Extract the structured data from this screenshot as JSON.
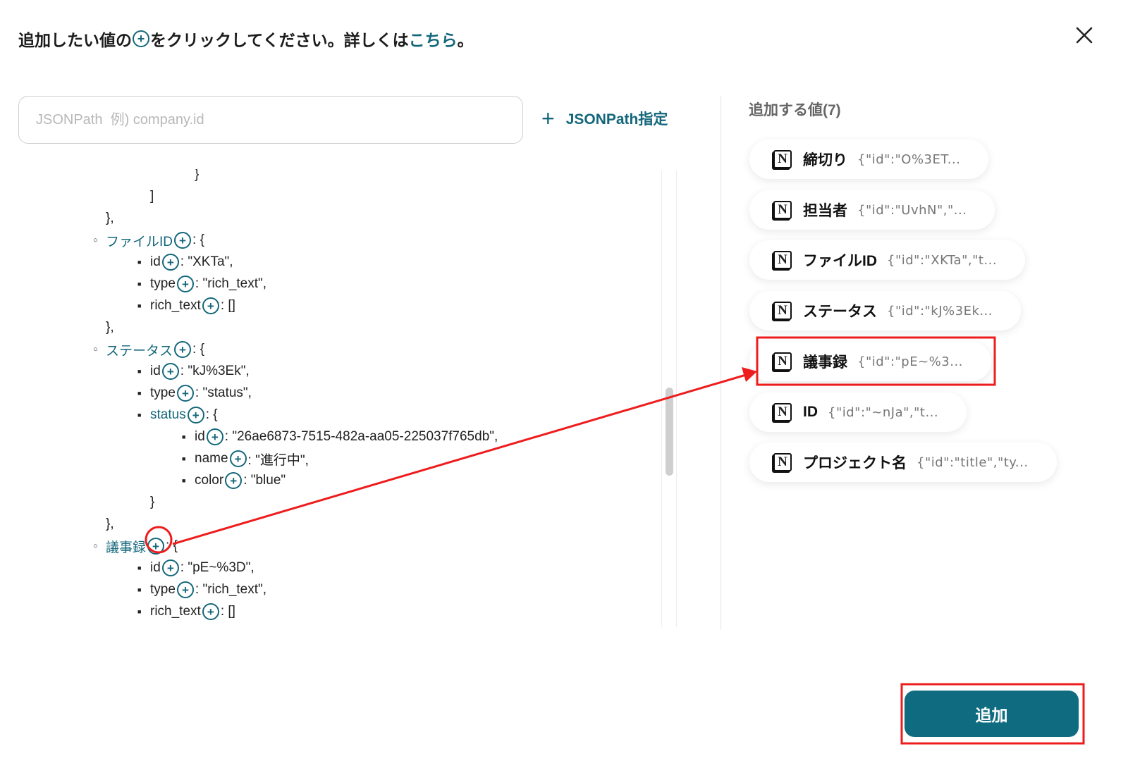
{
  "header": {
    "before": "追加したい値の",
    "after": "をクリックしてください。詳しくは",
    "link": "こちら",
    "end": "。"
  },
  "search": {
    "placeholder": "JSONPath  例) company.id",
    "value": ""
  },
  "jsonpath_button": "JSONPath指定",
  "tree": [
    {
      "level": 2,
      "type": "brace",
      "text": "}"
    },
    {
      "level": 1,
      "type": "brace",
      "text": "]"
    },
    {
      "level": 0,
      "type": "brace",
      "text": "},"
    },
    {
      "level": 0,
      "type": "obj",
      "key": "ファイルID",
      "suffix": ": {"
    },
    {
      "level": 1,
      "type": "kv",
      "key": "id",
      "suffix": ": \"XKTa\","
    },
    {
      "level": 1,
      "type": "kv",
      "key": "type",
      "suffix": ": \"rich_text\","
    },
    {
      "level": 1,
      "type": "kv",
      "key": "rich_text",
      "suffix": ": []"
    },
    {
      "level": 0,
      "type": "brace",
      "text": "},"
    },
    {
      "level": 0,
      "type": "obj",
      "key": "ステータス",
      "suffix": ": {"
    },
    {
      "level": 1,
      "type": "kv",
      "key": "id",
      "suffix": ": \"kJ%3Ek\","
    },
    {
      "level": 1,
      "type": "kv",
      "key": "type",
      "suffix": ": \"status\","
    },
    {
      "level": 1,
      "type": "obj",
      "key": "status",
      "suffix": ": {"
    },
    {
      "level": 2,
      "type": "kv",
      "key": "id",
      "suffix": ": \"26ae6873-7515-482a-aa05-225037f765db\","
    },
    {
      "level": 2,
      "type": "kv",
      "key": "name",
      "suffix": ": \"進行中\","
    },
    {
      "level": 2,
      "type": "kv",
      "key": "color",
      "suffix": ": \"blue\""
    },
    {
      "level": 1,
      "type": "brace",
      "text": "}"
    },
    {
      "level": 0,
      "type": "brace",
      "text": "},"
    },
    {
      "level": 0,
      "type": "obj",
      "key": "議事録",
      "suffix": ": {"
    },
    {
      "level": 1,
      "type": "kv",
      "key": "id",
      "suffix": ": \"pE~%3D\","
    },
    {
      "level": 1,
      "type": "kv",
      "key": "type",
      "suffix": ": \"rich_text\","
    },
    {
      "level": 1,
      "type": "kv",
      "key": "rich_text",
      "suffix": ": []"
    },
    {
      "level": 0,
      "type": "brace",
      "text": "},"
    }
  ],
  "right": {
    "title": "追加する値(7)",
    "items": [
      {
        "label": "締切り",
        "value": "{\"id\":\"O%3ET..."
      },
      {
        "label": "担当者",
        "value": "{\"id\":\"UvhN\",\"..."
      },
      {
        "label": "ファイルID",
        "value": "{\"id\":\"XKTa\",\"t..."
      },
      {
        "label": "ステータス",
        "value": "{\"id\":\"kJ%3Ek..."
      },
      {
        "label": "議事録",
        "value": "{\"id\":\"pE~%3...",
        "highlighted": true
      },
      {
        "label": "ID",
        "value": "{\"id\":\"~nJa\",\"t..."
      },
      {
        "label": "プロジェクト名",
        "value": "{\"id\":\"title\",\"ty..."
      }
    ]
  },
  "add_button": "追加",
  "colors": {
    "accent": "#14677b",
    "button": "#0f6b80",
    "annotation": "#ee1c1c"
  },
  "icons": {
    "close": "close-icon",
    "add": "plus-circle-icon",
    "item": "notion-icon"
  }
}
